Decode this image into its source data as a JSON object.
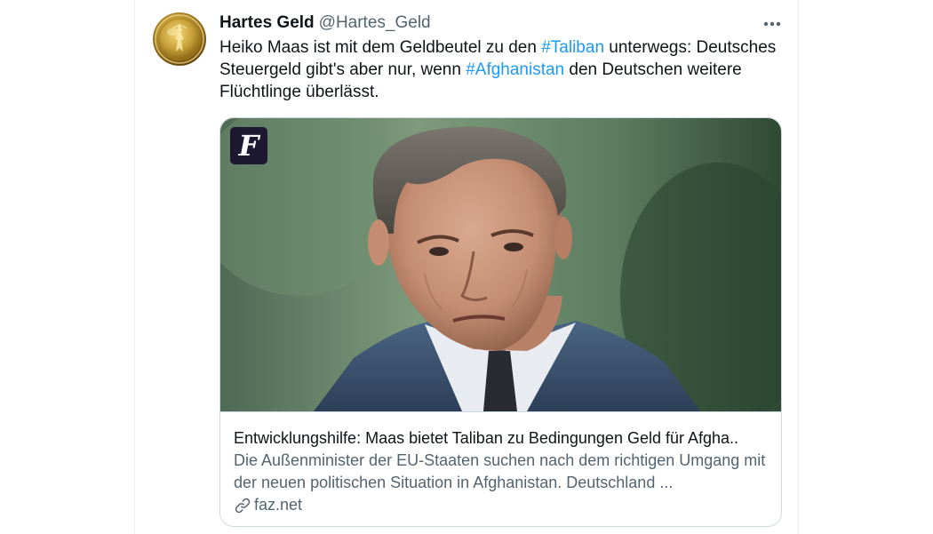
{
  "tweet": {
    "display_name": "Hartes Geld",
    "handle": "@Hartes_Geld",
    "text_1": "Heiko Maas ist mit dem Geldbeutel zu den ",
    "hashtag_1": "#Taliban",
    "text_2": " unterwegs: Deutsches Steuergeld gibt's aber nur, wenn ",
    "hashtag_2": "#Afghanistan",
    "text_3": " den Deutschen weitere Flüchtlinge überlässt."
  },
  "card": {
    "source_logo_letter": "F",
    "title": "Entwicklungshilfe: Maas bietet Taliban zu Bedingungen Geld für Afgha..",
    "description": "Die Außenminister der EU-Staaten suchen nach dem richtigen Umgang mit der neuen politischen Situation in Afghanistan. Deutschland ...",
    "domain": "faz.net",
    "domain_icon": "link-icon"
  },
  "icons": {
    "more": "more-horizontal-icon",
    "avatar": "gold-coin-avatar"
  },
  "colors": {
    "link": "#1d9bf0",
    "text": "#0f1419",
    "secondary": "#536471",
    "border": "#cfd9de"
  }
}
